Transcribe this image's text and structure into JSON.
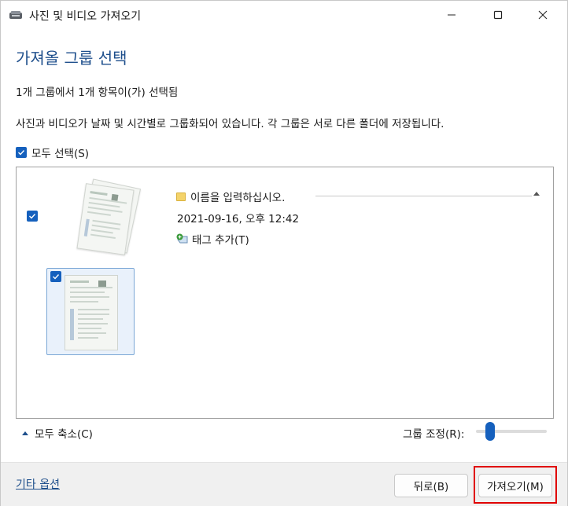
{
  "window": {
    "title": "사진 및 비디오 가져오기",
    "controls": {
      "minimize": "minimize",
      "maximize": "maximize",
      "close": "close"
    }
  },
  "heading": "가져올 그룹 선택",
  "summary": "1개 그룹에서 1개 항목이(가) 선택됨",
  "description": "사진과 비디오가 날짜 및 시간별로 그룹화되어 있습니다. 각 그룹은 서로 다른 폴더에 저장됩니다.",
  "select_all": {
    "label": "모두 선택(S)",
    "checked": true
  },
  "groups": [
    {
      "checked": true,
      "name_placeholder": "이름을 입력하십시오.",
      "date": "2021-09-16, 오후 12:42",
      "add_tag": "태그 추가(T)",
      "items": [
        {
          "checked": true
        }
      ]
    }
  ],
  "collapse_all": "모두 축소(C)",
  "group_adjust": {
    "label": "그룹 조정(R):",
    "value_fraction": 0.2
  },
  "footer": {
    "more_options": "기타 옵션",
    "back": "뒤로(B)",
    "import": "가져오기(M)"
  },
  "colors": {
    "accent": "#1560bd",
    "heading": "#1e4f8c",
    "highlight": "#e00000"
  }
}
